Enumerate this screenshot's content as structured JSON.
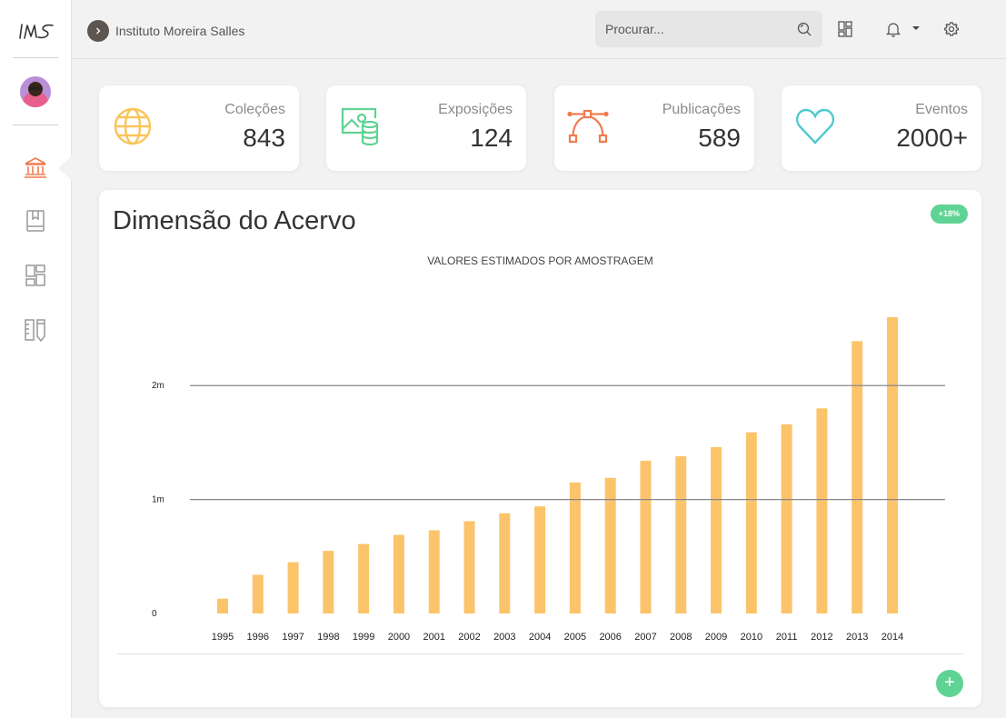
{
  "sidebar": {
    "logo_text": "IMS",
    "active_item": "acervo",
    "icons": [
      "institution-icon",
      "book-icon",
      "dashboard-icon",
      "ruler-pencil-icon"
    ]
  },
  "breadcrumb": {
    "label": "Instituto Moreira Salles"
  },
  "search": {
    "placeholder": "Procurar..."
  },
  "stats": [
    {
      "label": "Coleções",
      "value": "843",
      "icon": "globe-icon",
      "color": "#f9c45a"
    },
    {
      "label": "Exposições",
      "value": "124",
      "icon": "picture-database-icon",
      "color": "#5fd393"
    },
    {
      "label": "Publicações",
      "value": "589",
      "icon": "bezier-curve-icon",
      "color": "#f07a4f"
    },
    {
      "label": "Eventos",
      "value": "2000+",
      "icon": "heart-icon",
      "color": "#4fc9cf"
    }
  ],
  "panel": {
    "title": "Dimensão do Acervo",
    "badge": "+18%",
    "fab_label": "+"
  },
  "chart_data": {
    "type": "bar",
    "title": "VALORES ESTIMADOS POR AMOSTRAGEM",
    "categories": [
      "1995",
      "1996",
      "1997",
      "1998",
      "1999",
      "2000",
      "2001",
      "2002",
      "2003",
      "2004",
      "2005",
      "2006",
      "2007",
      "2008",
      "2009",
      "2010",
      "2011",
      "2012",
      "2013",
      "2014"
    ],
    "values": [
      130000,
      340000,
      450000,
      550000,
      610000,
      690000,
      730000,
      810000,
      880000,
      940000,
      1150000,
      1190000,
      1340000,
      1380000,
      1460000,
      1590000,
      1660000,
      1800000,
      2390000,
      2600000
    ],
    "y_ticks": [
      {
        "value": 0,
        "label": "0"
      },
      {
        "value": 1000000,
        "label": "1m"
      },
      {
        "value": 2000000,
        "label": "2m"
      }
    ],
    "ylim": [
      0,
      2600000
    ],
    "grid": true,
    "bar_color": "#fbc46b"
  }
}
